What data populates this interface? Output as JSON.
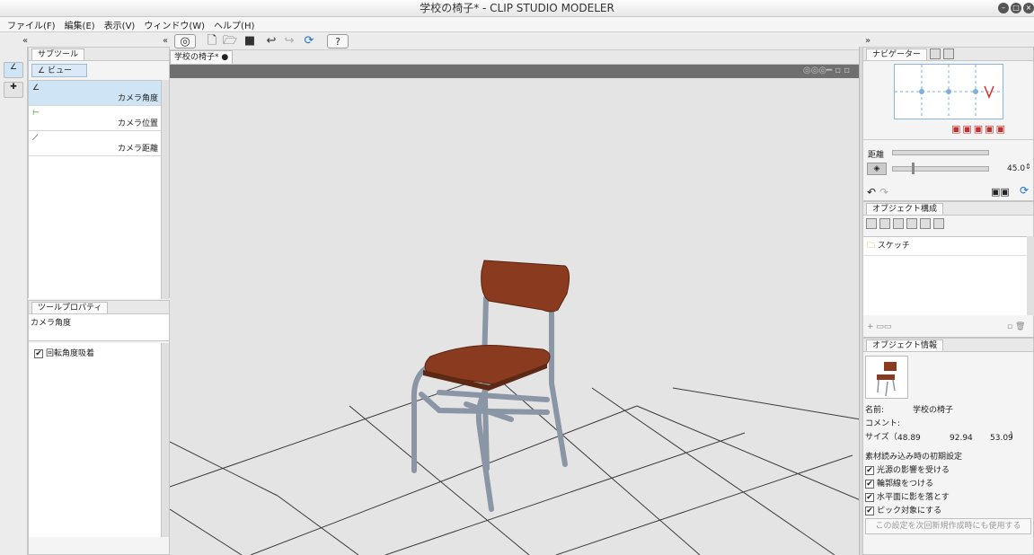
{
  "window": {
    "title": "学校の椅子* - CLIP STUDIO MODELER"
  },
  "menu": [
    "ファイル(F)",
    "編集(E)",
    "表示(V)",
    "ウィンドウ(W)",
    "ヘルプ(H)"
  ],
  "document_tab": "学校の椅子*",
  "subtool": {
    "tab_label": "サブツール",
    "group_label": "ビュー",
    "items": [
      "カメラ角度",
      "カメラ位置",
      "カメラ距離"
    ]
  },
  "tool_property": {
    "tab_label": "ツールプロパティ",
    "heading": "カメラ角度",
    "checkbox_label": "回転角度吸着"
  },
  "navigator": {
    "tab_label": "ナビゲーター",
    "distance_label": "距離",
    "fov_value": "45.0"
  },
  "object_structure": {
    "tab_label": "オブジェクト構成",
    "items": [
      "スケッチ"
    ]
  },
  "object_info": {
    "tab_label": "オブジェクト情報",
    "name_label": "名前:",
    "name_value": "学校の椅子",
    "comment_label": "コメント:",
    "size_label": "サイズ（",
    "size_x": "48.89",
    "size_y": "92.94",
    "size_z": "53.09",
    "size_close": ")",
    "settings_title": "素材読み込み時の初期設定",
    "settings": [
      "光源の影響を受ける",
      "輪郭線をつける",
      "水平面に影を落とす",
      "ピック対象にする"
    ],
    "apply_button": "この設定を次回新規作成時にも使用する"
  },
  "colors": {
    "seat": "#8a3a1e",
    "frame": "#8a96a6",
    "viewport_bg": "#e4e4e4"
  }
}
